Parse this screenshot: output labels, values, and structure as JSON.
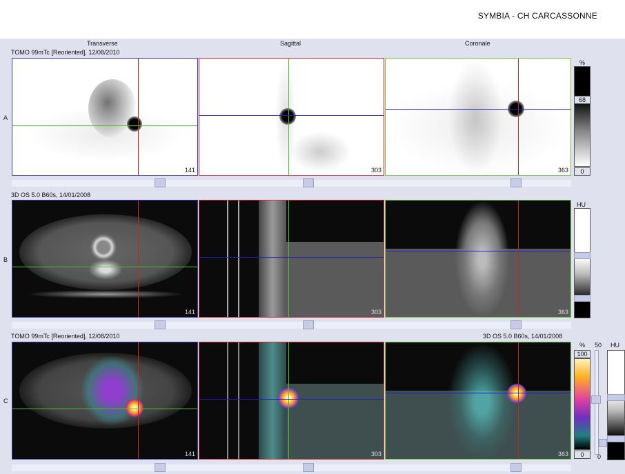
{
  "header": {
    "title": "SYMBIA - CH CARCASSONNE"
  },
  "columns": {
    "transverse": "Transverse",
    "sagittal": "Sagittal",
    "coronal": "Coronale"
  },
  "rows": {
    "a": {
      "letter": "A",
      "series": "TOMO 99mTc [Reoriented], 12/08/2010"
    },
    "b": {
      "letter": "B",
      "series": "3D  OS  5.0  B60s, 14/01/2008"
    },
    "c": {
      "letter": "C",
      "series_left": "TOMO 99mTc [Reoriented], 12/08/2010",
      "series_right": "3D  OS  5.0  B60s, 14/01/2008"
    }
  },
  "slices": {
    "transverse": "141",
    "sagittal": "303",
    "coronal": "363"
  },
  "scales": {
    "a": {
      "unit": "%",
      "mid": "68",
      "low": "0"
    },
    "b": {
      "unit": "HU"
    },
    "c": {
      "unit_pct": "%",
      "top_pct": "100",
      "low_pct": "0",
      "mid": "50",
      "unit_hu": "HU",
      "low_hu": "0"
    }
  },
  "colors": {
    "transverse_frame": "#3a3aa8",
    "sagittal_frame": "#c83030",
    "coronal_frame": "#6cc83c",
    "crosshair_red": "#d02020",
    "crosshair_green": "#50c030",
    "crosshair_blue": "#2020c0",
    "hot_spot": "#ffb020"
  }
}
